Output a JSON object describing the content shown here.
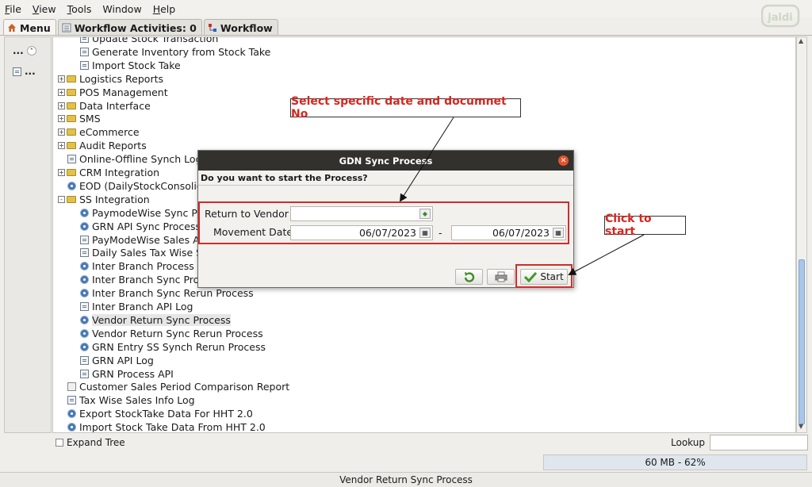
{
  "menubar": {
    "items": [
      "File",
      "View",
      "Tools",
      "Window",
      "Help"
    ],
    "underline": [
      "F",
      "V",
      "T",
      "",
      "H"
    ]
  },
  "logo": {
    "text": "jaldi",
    "color": "#cfd6c6"
  },
  "tabs": [
    {
      "label": "Menu",
      "icon": "home-icon",
      "active": true
    },
    {
      "label": "Workflow Activities: 0",
      "icon": "list-icon",
      "active": false
    },
    {
      "label": "Workflow",
      "icon": "workflow-icon",
      "active": false
    }
  ],
  "leftpanel": {
    "row1": "...",
    "row2": "..."
  },
  "tree": [
    {
      "label": "Update Stock Transaction",
      "icon": "doc",
      "indent": 2
    },
    {
      "label": "Generate Inventory from Stock Take",
      "icon": "doc",
      "indent": 2
    },
    {
      "label": "Import Stock Take",
      "icon": "doc",
      "indent": 2
    },
    {
      "label": "Logistics Reports",
      "icon": "folder",
      "indent": 0,
      "expander": "+"
    },
    {
      "label": "POS Management",
      "icon": "folder",
      "indent": 0,
      "expander": "+"
    },
    {
      "label": "Data Interface",
      "icon": "folder",
      "indent": 0,
      "expander": "+"
    },
    {
      "label": "SMS",
      "icon": "folder",
      "indent": 0,
      "expander": "+"
    },
    {
      "label": "eCommerce",
      "icon": "folder",
      "indent": 0,
      "expander": "+"
    },
    {
      "label": "Audit Reports",
      "icon": "folder",
      "indent": 0,
      "expander": "+"
    },
    {
      "label": "Online-Offline Synch Log",
      "icon": "doc",
      "indent": 1
    },
    {
      "label": "CRM Integration",
      "icon": "folder",
      "indent": 0,
      "expander": "+"
    },
    {
      "label": "EOD (DailyStockConsolid",
      "icon": "gear",
      "indent": 1
    },
    {
      "label": "SS Integration",
      "icon": "folder",
      "indent": 0,
      "expander": "-"
    },
    {
      "label": "PaymodeWise Sync Pro",
      "icon": "gear",
      "indent": 2
    },
    {
      "label": "GRN API Sync Process",
      "icon": "gear",
      "indent": 2
    },
    {
      "label": "PayModeWise Sales AP",
      "icon": "doc",
      "indent": 2
    },
    {
      "label": "Daily Sales Tax Wise S",
      "icon": "doc",
      "indent": 2
    },
    {
      "label": "Inter Branch Process A",
      "icon": "gear",
      "indent": 2
    },
    {
      "label": "Inter Branch Sync Proc",
      "icon": "gear",
      "indent": 2
    },
    {
      "label": "Inter Branch Sync Rerun Process",
      "icon": "gear",
      "indent": 2
    },
    {
      "label": "Inter Branch API Log",
      "icon": "doc",
      "indent": 2
    },
    {
      "label": "Vendor Return Sync Process",
      "icon": "gear",
      "indent": 2,
      "selected": true
    },
    {
      "label": "Vendor Return Sync Rerun Process",
      "icon": "gear",
      "indent": 2
    },
    {
      "label": "GRN Entry SS Synch Rerun Process",
      "icon": "gear",
      "indent": 2
    },
    {
      "label": "GRN API Log",
      "icon": "doc",
      "indent": 2
    },
    {
      "label": "GRN Process API",
      "icon": "doc",
      "indent": 2
    },
    {
      "label": "Customer Sales Period Comparison Report",
      "icon": "sq",
      "indent": 1
    },
    {
      "label": "Tax Wise Sales Info Log",
      "icon": "doc",
      "indent": 1
    },
    {
      "label": "Export StockTake Data For HHT 2.0",
      "icon": "gear",
      "indent": 1
    },
    {
      "label": "Import Stock Take Data From HHT 2.0",
      "icon": "gear",
      "indent": 1
    }
  ],
  "bottombar": {
    "expand_tree": "Expand Tree",
    "lookup": "Lookup",
    "lookup_value": ""
  },
  "memory": "60 MB - 62%",
  "status": "Vendor Return Sync Process",
  "dialog": {
    "title": "GDN Sync Process",
    "question": "Do you want to start the Process?",
    "return_to_vendor_label": "Return to Vendor",
    "return_to_vendor_value": "",
    "movement_date_label": "Movement Date",
    "date_from": "06/07/2023",
    "date_to": "06/07/2023",
    "dash": "-",
    "start_label": "Start"
  },
  "annotations": {
    "callout1": "Select specific date and documnet No",
    "callout2": "Click to start",
    "color": "#d22b2b"
  }
}
